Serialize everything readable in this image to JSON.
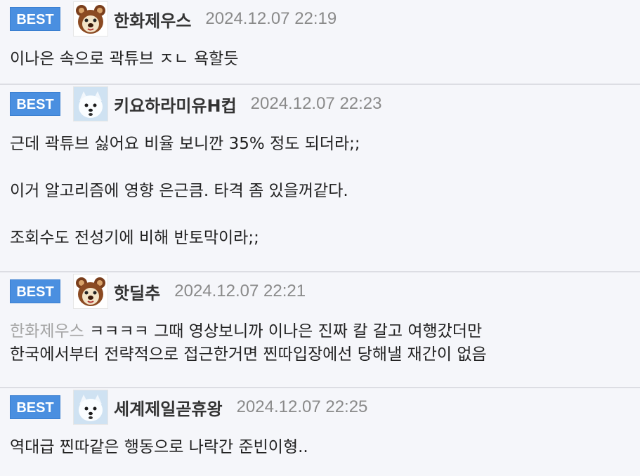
{
  "badge_label": "BEST",
  "colors": {
    "badge": "#4a8fe0",
    "date": "#8a8a8a",
    "mention": "#a5a5a5",
    "background": "#f5f6fa"
  },
  "comments": [
    {
      "author": "한화제우스",
      "avatar": "bear-avatar-icon",
      "date": "2024.12.07 22:19",
      "lines": [
        "이나은 속으로 곽튜브 ㅈㄴ 욕할듯"
      ]
    },
    {
      "author": "키요하라미유H컵",
      "avatar": "white-dog-avatar-icon",
      "date": "2024.12.07 22:23",
      "lines": [
        "근데 곽튜브 싫어요 비율 보니깐 35% 정도 되더라;;",
        "이거 알고리즘에 영향 은근큼. 타격 좀 있을꺼같다.",
        "조회수도 전성기에 비해 반토막이라;;"
      ]
    },
    {
      "author": "핫딜추",
      "avatar": "bear-avatar-icon",
      "date": "2024.12.07 22:21",
      "mention": "한화제우스",
      "lines": [
        " ㅋㅋㅋㅋ 그때 영상보니까 이나은 진짜 칼 갈고 여행갔더만",
        "한국에서부터 전략적으로 접근한거면 찐따입장에선 당해낼 재간이 없음"
      ]
    },
    {
      "author": "세계제일곧휴왕",
      "avatar": "white-dog-avatar-icon",
      "date": "2024.12.07 22:25",
      "lines": [
        "역대급 찐따같은 행동으로 나락간 준빈이형.."
      ]
    }
  ]
}
